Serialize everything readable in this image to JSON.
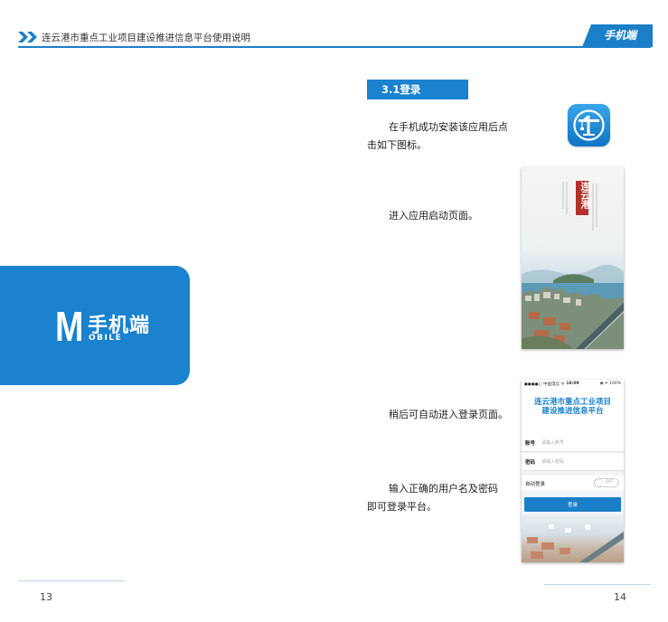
{
  "header": {
    "title": "连云港市重点工业项目建设推进信息平台使用说明",
    "tab_label": "手机端"
  },
  "left_block": {
    "big_letter": "M",
    "cn_label": "手机端",
    "en_label": "OBILE"
  },
  "section": {
    "heading": "3.1登录"
  },
  "paragraphs": {
    "p1_line1": "在手机成功安装该应用后点",
    "p1_line2": "击如下图标。",
    "p2": "进入应用启动页面。",
    "p3": "稍后可自动进入登录页面。",
    "p4_line1": "输入正确的用户名及密码",
    "p4_line2": "即可登录平台。"
  },
  "splash": {
    "seal_text": "连云港"
  },
  "login_screen": {
    "status_left": "●●●●○ 中国电信 ᯤ",
    "status_time": "18:09",
    "status_right": "◉ ✈ 100%",
    "title_line1": "连云港市重点工业项目",
    "title_line2": "建设推进信息平台",
    "account_label": "账号",
    "account_placeholder": "请输入账号",
    "password_label": "密码",
    "password_placeholder": "请输入密码",
    "auto_login_label": "自动登录",
    "toggle_text": "OFF",
    "login_button": "登录"
  },
  "footer": {
    "page_left": "13",
    "page_right": "14"
  },
  "colors": {
    "brand_blue": "#1a82cf",
    "seal_red": "#b2322a"
  }
}
